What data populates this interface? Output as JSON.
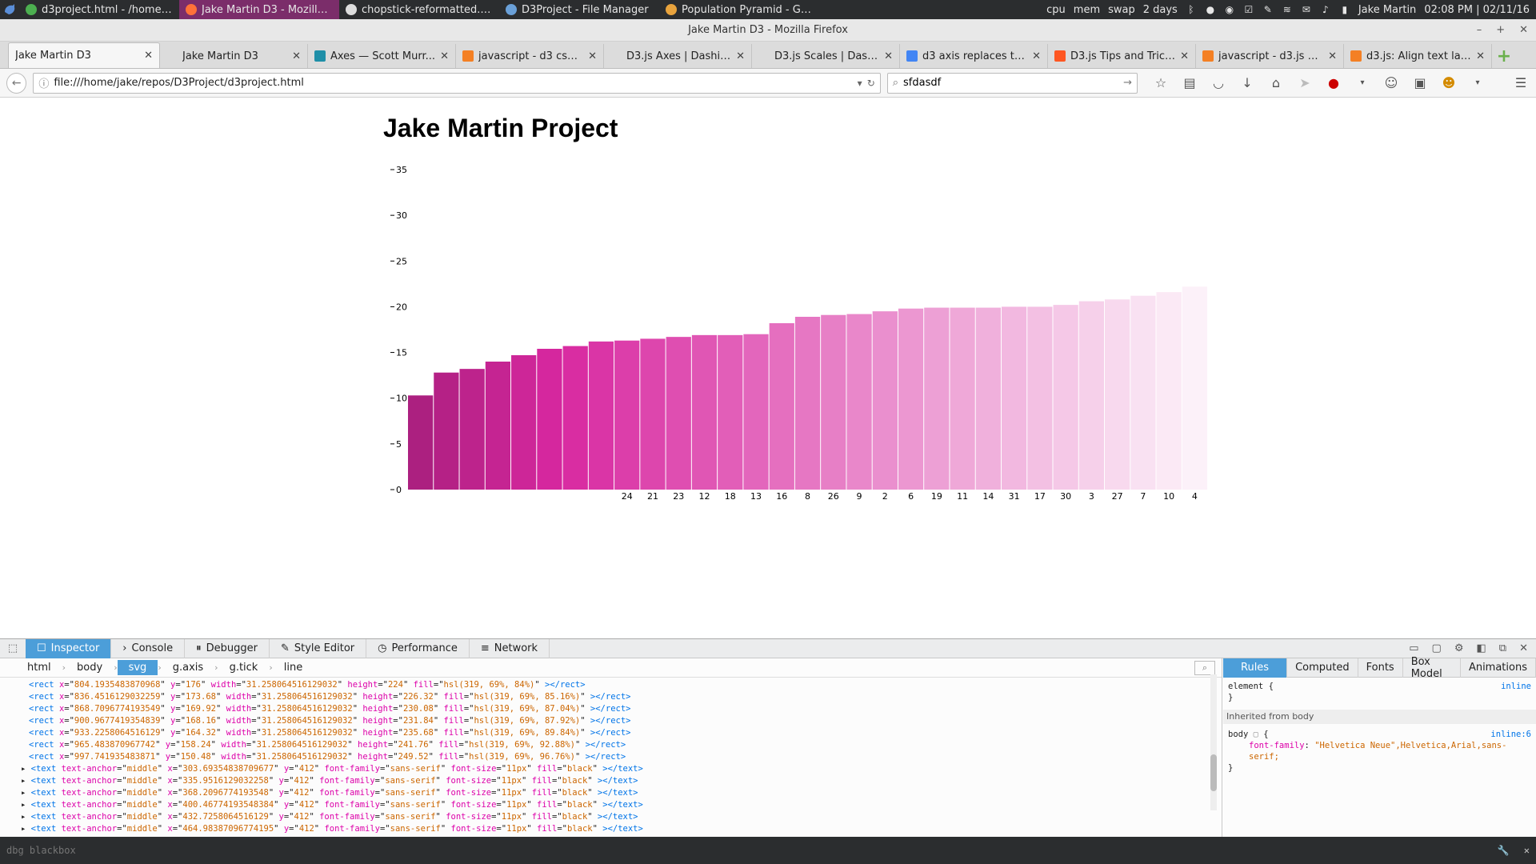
{
  "os_panel": {
    "tasks": [
      {
        "label": "d3project.html - /home/ja...",
        "color": "#4caf50",
        "active": false
      },
      {
        "label": "Jake Martin D3 - Mozilla Fir...",
        "color": "#ff7139",
        "active": true
      },
      {
        "label": "chopstick-reformatted.csv ...",
        "color": "#dddddd",
        "active": false
      },
      {
        "label": "D3Project - File Manager",
        "color": "#6aa0d8",
        "active": false
      },
      {
        "label": "Population Pyramid - Goo...",
        "color": "#e8a33d",
        "active": false
      }
    ],
    "tray": {
      "cpu": "cpu",
      "mem": "mem",
      "swap": "swap",
      "uptime": "2 days",
      "user": "Jake Martin",
      "clock": "02:08 PM | 02/11/16"
    }
  },
  "window": {
    "title": "Jake Martin D3 - Mozilla Firefox"
  },
  "tabs": [
    {
      "title": "Jake Martin D3",
      "active": true,
      "fav": "#ffffff"
    },
    {
      "title": "Jake Martin D3",
      "active": false,
      "fav": "#dcdcdc"
    },
    {
      "title": "Axes — Scott Murr...",
      "active": false,
      "fav": "#1f8fa8"
    },
    {
      "title": "javascript - d3 csv d...",
      "active": false,
      "fav": "#f48024"
    },
    {
      "title": "D3.js Axes | DashingD3...",
      "active": false,
      "fav": "#dcdcdc"
    },
    {
      "title": "D3.js Scales | DashingD...",
      "active": false,
      "fav": "#dcdcdc"
    },
    {
      "title": "d3 axis replaces tex...",
      "active": false,
      "fav": "#4285f4"
    },
    {
      "title": "D3.js Tips and Trick...",
      "active": false,
      "fav": "#ff5722"
    },
    {
      "title": "javascript - d3.js Sp...",
      "active": false,
      "fav": "#f48024"
    },
    {
      "title": "d3.js: Align text lab...",
      "active": false,
      "fav": "#f48024"
    }
  ],
  "navbar": {
    "url": "file:///home/jake/repos/D3Project/d3project.html",
    "search_value": "sfdasdf"
  },
  "page": {
    "title": "Jake Martin Project"
  },
  "chart_data": {
    "type": "bar",
    "title": "",
    "xlabel": "",
    "ylabel": "",
    "ylim": [
      0,
      35
    ],
    "yticks": [
      "0",
      "5",
      "10",
      "15",
      "20",
      "25",
      "30",
      "35"
    ],
    "values": [
      10.3,
      12.8,
      13.2,
      14.0,
      14.7,
      15.4,
      15.7,
      16.2,
      16.3,
      16.5,
      16.7,
      16.9,
      16.9,
      17.0,
      18.2,
      18.9,
      19.1,
      19.2,
      19.5,
      19.8,
      19.9,
      19.9,
      19.9,
      20.0,
      20.0,
      20.2,
      20.6,
      20.8,
      21.2,
      21.6,
      22.2
    ],
    "x_tick_labels": [
      "",
      "",
      "",
      "",
      "",
      "",
      "",
      "",
      "24",
      "21",
      "23",
      "12",
      "18",
      "13",
      "16",
      "8",
      "26",
      "9",
      "2",
      "6",
      "19",
      "11",
      "14",
      "31",
      "17",
      "30",
      "3",
      "27",
      "7",
      "10",
      "4"
    ],
    "color_hue": 319,
    "color_saturation": 69
  },
  "devtools": {
    "tabs": [
      "Inspector",
      "Console",
      "Debugger",
      "Style Editor",
      "Performance",
      "Network"
    ],
    "breadcrumbs": [
      "html",
      "body",
      "svg",
      "g.axis",
      "g.tick",
      "line"
    ],
    "markup_lines": [
      {
        "x": "804.1935483870968",
        "y": "176",
        "width": "31.258064516129032",
        "height": "224",
        "fill": "hsl(319, 69%, 84%)"
      },
      {
        "x": "836.4516129032259",
        "y": "173.68",
        "width": "31.258064516129032",
        "height": "226.32",
        "fill": "hsl(319, 69%, 85.16%)"
      },
      {
        "x": "868.7096774193549",
        "y": "169.92",
        "width": "31.258064516129032",
        "height": "230.08",
        "fill": "hsl(319, 69%, 87.04%)"
      },
      {
        "x": "900.9677419354839",
        "y": "168.16",
        "width": "31.258064516129032",
        "height": "231.84",
        "fill": "hsl(319, 69%, 87.92%)"
      },
      {
        "x": "933.2258064516129",
        "y": "164.32",
        "width": "31.258064516129032",
        "height": "235.68",
        "fill": "hsl(319, 69%, 89.84%)"
      },
      {
        "x": "965.483870967742",
        "y": "158.24",
        "width": "31.258064516129032",
        "height": "241.76",
        "fill": "hsl(319, 69%, 92.88%)"
      },
      {
        "x": "997.741935483871",
        "y": "150.48",
        "width": "31.258064516129032",
        "height": "249.52",
        "fill": "hsl(319, 69%, 96.76%)"
      }
    ],
    "text_lines": [
      {
        "x": "303.69354838709677",
        "y": "412"
      },
      {
        "x": "335.9516129032258",
        "y": "412"
      },
      {
        "x": "368.2096774193548",
        "y": "412"
      },
      {
        "x": "400.46774193548384",
        "y": "412"
      },
      {
        "x": "432.7258064516129",
        "y": "412"
      },
      {
        "x": "464.98387096774195",
        "y": "412"
      },
      {
        "x": "497.241935483871",
        "y": "412"
      }
    ],
    "text_attrs": {
      "anchor": "middle",
      "family": "sans-serif",
      "size": "11px",
      "fill": "black"
    },
    "side_tabs": [
      "Rules",
      "Computed",
      "Fonts",
      "Box Model",
      "Animations"
    ],
    "rules": {
      "element_selector": "element {",
      "element_source": "inline",
      "close": "}",
      "inherited_label": "Inherited from body",
      "body_selector": "body",
      "body_source": "inline:6",
      "prop_name": "font-family",
      "prop_value": "\"Helvetica Neue\",Helvetica,Arial,sans-serif;"
    }
  },
  "cmdbar": {
    "placeholder": "dbg blackbox"
  }
}
